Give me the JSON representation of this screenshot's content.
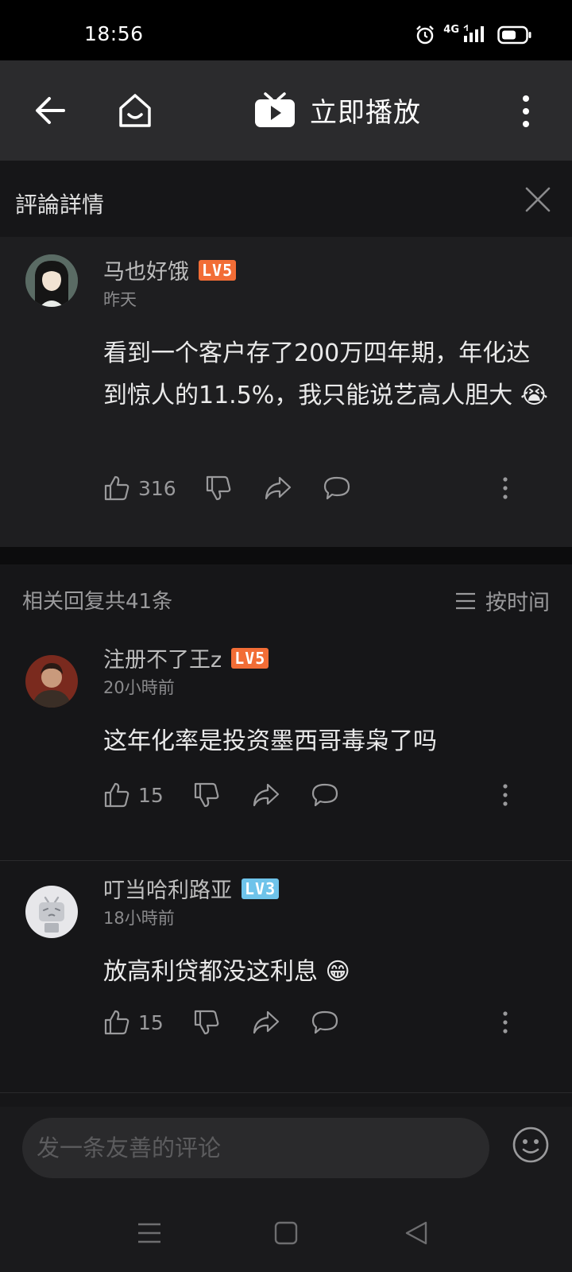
{
  "status_bar": {
    "time": "18:56",
    "network": "4G"
  },
  "nav": {
    "title": "立即播放"
  },
  "detail": {
    "title": "評論詳情"
  },
  "main_comment": {
    "username": "马也好饿",
    "level": "LV5",
    "time": "昨天",
    "text": "看到一个客户存了200万四年期，年化达到惊人的11.5%，我只能说艺高人胆大",
    "emoji": "😭",
    "likes": "316"
  },
  "replies": {
    "count_label": "相关回复共41条",
    "sort_label": "按时间",
    "items": [
      {
        "username": "注册不了王z",
        "level": "LV5",
        "time": "20小時前",
        "text": "这年化率是投资墨西哥毒枭了吗",
        "emoji": "",
        "likes": "15"
      },
      {
        "username": "叮当哈利路亚",
        "level": "LV3",
        "time": "18小時前",
        "text": "放高利贷都没这利息",
        "emoji": "😁",
        "likes": "15"
      }
    ]
  },
  "input": {
    "placeholder": "发一条友善的评论"
  },
  "colors": {
    "accent_lv5": "#f26d36",
    "accent_lv3": "#6ec3ea",
    "background": "#161618"
  }
}
